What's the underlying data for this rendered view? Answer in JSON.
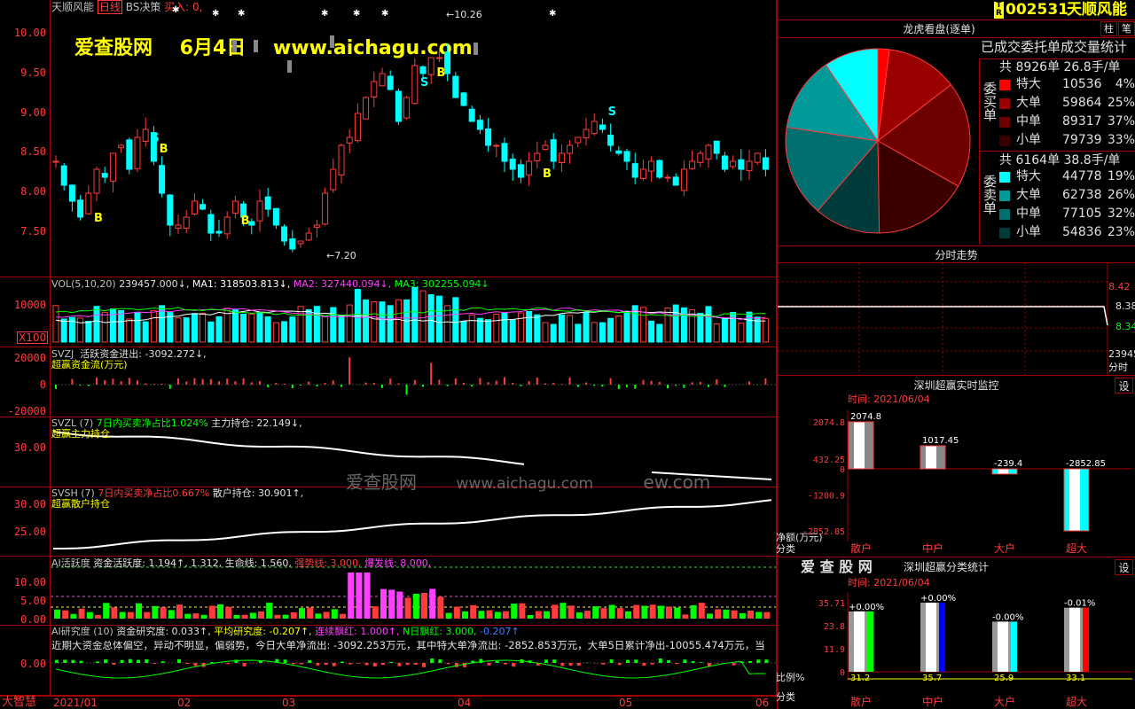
{
  "header": {
    "title": "天顺风能",
    "period": "日线",
    "strategy": "BS决策",
    "buy_signal": "买入: 0,"
  },
  "watermark": {
    "site": "爱查股网",
    "date": "6月4日",
    "url": "www.aichagu.com",
    "mid_site": "爱查股网",
    "mid_url": "www.aichagu.com",
    "mid_ghost": "ew.com"
  },
  "kline": {
    "yticks": [
      "10.00",
      "9.50",
      "9.00",
      "8.50",
      "8.00",
      "7.50"
    ],
    "high_label": "←10.26",
    "low_label": "←7.20",
    "signals": [
      "B",
      "B",
      "S",
      "B",
      "S",
      "B",
      "S",
      "B"
    ]
  },
  "vol": {
    "title": "VOL(5,10,20)",
    "value": "239457.000↓,",
    "ma1": "MA1: 318503.813↓,",
    "ma2": "MA2: 327440.094↓,",
    "ma3": "MA3: 302255.094↓",
    "yticks": [
      "10000"
    ],
    "unit": "X100"
  },
  "svzj": {
    "title": "SVZJ",
    "label": "活跃资金进出: -3092.272↓,",
    "sub": "超赢资金流(万元)",
    "yticks": [
      "20000",
      "0",
      "-20000"
    ]
  },
  "svzl": {
    "title": "SVZL (7)",
    "label1": "7日内买卖净占比1.024%",
    "label2": "主力持仓: 22.149↓,",
    "sub": "超赢主力持仓",
    "yticks": [
      "30.00"
    ]
  },
  "svsh": {
    "title": "SVSH (7)",
    "label1": "7日内买卖净占比0.667%",
    "label2": "散户持仓: 30.901↑,",
    "sub": "超赢散户持仓",
    "yticks": [
      "30.00",
      "25.00"
    ]
  },
  "aihy": {
    "title": "AI活跃度",
    "label1": "资金活跃度: 1.194↑, 1.312, 生命线: 1.560,",
    "label2": "强势线: 3.000,",
    "label3": "爆发线: 8.000,",
    "yticks": [
      "10.00",
      "5.00",
      "0.00"
    ]
  },
  "aiyj": {
    "title": "AI研究度 (10)",
    "label1": "资金研究度: 0.033↑,",
    "label2": "平均研究度: -0.207↑,",
    "label3": "连续飘红: 1.000↑,",
    "label4": "N日飘红: 3.000,",
    "label5": "-0.207↑",
    "message": "近期大资金总体偏空，异动不明显，偏弱势，今日大单净流出: -3092.253万元，其中特大单净流出: -2852.853万元，大单5日累计净出-10055.474万元，当",
    "yticks": [
      "0.00"
    ]
  },
  "xaxis": {
    "labels": [
      "2021/01",
      "02",
      "03",
      "04",
      "05",
      "06"
    ]
  },
  "brand": "大智慧",
  "stock": {
    "code": "002531",
    "name": "天顺风能",
    "flag": "T R",
    "btn1": "柱",
    "btn2": "笔"
  },
  "dragon": {
    "title": "龙虎看盘(逐单)",
    "subtitle": "已成交委托单成交量统计",
    "buy": {
      "side": "委买单",
      "total": "共 8926单 26.8手/单",
      "rows": [
        {
          "name": "特大",
          "num": "10536",
          "pct": "4%",
          "color": "#ff0000"
        },
        {
          "name": "大单",
          "num": "59864",
          "pct": "25%",
          "color": "#9a0000"
        },
        {
          "name": "中单",
          "num": "89317",
          "pct": "37%",
          "color": "#6e0000"
        },
        {
          "name": "小单",
          "num": "79739",
          "pct": "33%",
          "color": "#3a0000"
        }
      ]
    },
    "sell": {
      "side": "委卖单",
      "total": "共 6164单 38.8手/单",
      "rows": [
        {
          "name": "特大",
          "num": "44778",
          "pct": "19%",
          "color": "#00ffff"
        },
        {
          "name": "大单",
          "num": "62738",
          "pct": "26%",
          "color": "#009a9a"
        },
        {
          "name": "中单",
          "num": "77105",
          "pct": "32%",
          "color": "#006f6f"
        },
        {
          "name": "小单",
          "num": "54836",
          "pct": "23%",
          "color": "#003a3a"
        }
      ]
    }
  },
  "intraday": {
    "title": "分时走势",
    "prices": [
      "8.42",
      "8.38",
      "8.34"
    ],
    "vol": "23945",
    "vol_label": "分时"
  },
  "monitor": {
    "title": "深圳超赢实时监控",
    "btn": "设",
    "time": "时间: 2021/06/04",
    "yticks": [
      "2074.8",
      "432.25",
      "0",
      "-1200.9",
      "-2852.85"
    ],
    "ylab": "净额(万元)",
    "xlab": "分类",
    "bars": [
      {
        "name": "散户",
        "value": 2074.8,
        "label": "2074.8"
      },
      {
        "name": "中户",
        "value": 1017.45,
        "label": "1017.45"
      },
      {
        "name": "大户",
        "value": -239.4,
        "label": "-239.4"
      },
      {
        "name": "超大",
        "value": -2852.85,
        "label": "-2852.85"
      }
    ]
  },
  "stats": {
    "logo": "爱 查 股 网",
    "title": "深圳超赢分类统计",
    "btn": "设",
    "time": "时间: 2021/06/04",
    "yticks": [
      "35.71",
      "23.8",
      "11.9",
      "0"
    ],
    "ylab": "比例%",
    "xlab": "分类",
    "bars": [
      {
        "name": "散户",
        "value": 31.2,
        "change": "+0.00%",
        "label": "31.2",
        "color": "#00ff00"
      },
      {
        "name": "中户",
        "value": 35.7,
        "change": "+0.00%",
        "label": "35.7",
        "color": "#0000ff"
      },
      {
        "name": "大户",
        "value": 25.9,
        "change": "-0.00%",
        "label": "25.9",
        "color": "#00ffff"
      },
      {
        "name": "超大",
        "value": 33.1,
        "change": "-0.01%",
        "label": "33.1",
        "color": "#ff0000"
      }
    ]
  }
}
